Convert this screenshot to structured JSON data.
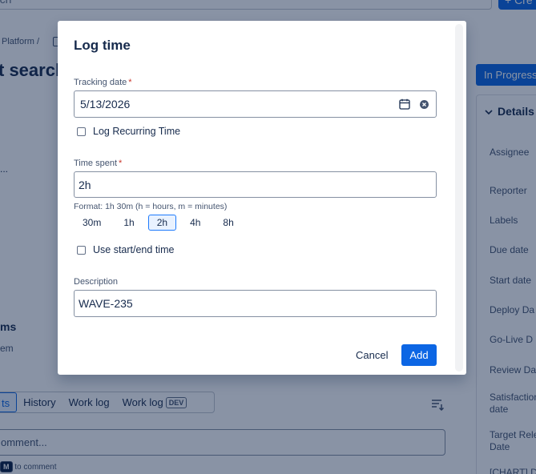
{
  "background": {
    "search_text": "rch",
    "create_label": "+ Cre",
    "breadcrumb": "Platform /",
    "page_title": "t search",
    "dots": "...",
    "section_title": "ms",
    "section_sub": "em",
    "tabs": [
      {
        "label": "ts",
        "active": true
      },
      {
        "label": "History"
      },
      {
        "label": "Work log"
      },
      {
        "label": "Work log",
        "badge": "DEV"
      }
    ],
    "comment_placeholder": "omment...",
    "tip_key": "M",
    "tip_text": "to comment",
    "status_label": "In Progress",
    "details_title": "Details",
    "fields": [
      "Assignee",
      "Reporter",
      "Labels",
      "Due date",
      "Start date",
      "Deploy Da",
      "Go-Live D",
      "Review Da",
      "Satisfaction date",
      "Target Rele Date",
      "[CHART] D"
    ]
  },
  "modal": {
    "title": "Log time",
    "tracking_date_label": "Tracking date",
    "required_mark": "*",
    "tracking_date_value": "5/13/2026",
    "log_recurring_label": "Log Recurring Time",
    "time_spent_label": "Time spent",
    "time_spent_value": "2h",
    "format_helper": "Format: 1h 30m (h = hours, m = minutes)",
    "presets": [
      {
        "label": "30m"
      },
      {
        "label": "1h"
      },
      {
        "label": "2h",
        "active": true
      },
      {
        "label": "4h"
      },
      {
        "label": "8h"
      }
    ],
    "use_start_end_label": "Use start/end time",
    "description_label": "Description",
    "description_value": "WAVE-235",
    "cancel_label": "Cancel",
    "add_label": "Add"
  },
  "colors": {
    "primary": "#0c66e4",
    "required": "#c9372c",
    "overlay": "rgba(9,30,66,0.48)"
  }
}
